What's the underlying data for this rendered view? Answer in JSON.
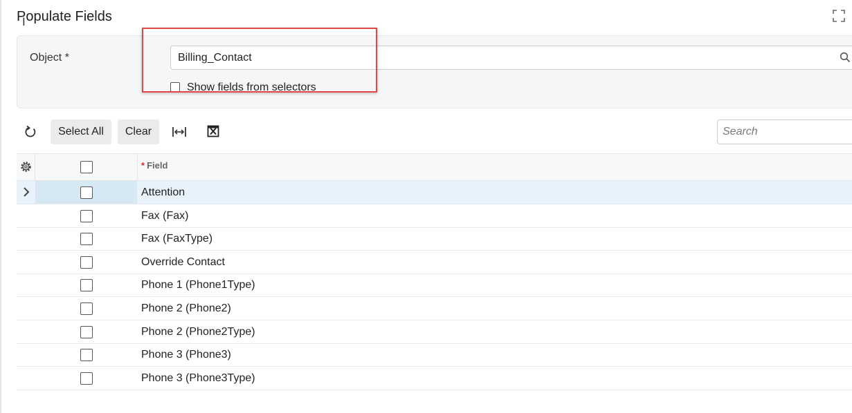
{
  "dialog": {
    "title": "Populate Fields",
    "maximize_icon": "expand-icon"
  },
  "form": {
    "object_label": "Object *",
    "object_value": "Billing_Contact",
    "object_lookup_icon": "search-icon",
    "show_selectors_label": "Show fields from selectors",
    "show_selectors_checked": false,
    "highlight_color": "#e04848"
  },
  "toolbar": {
    "refresh_icon": "refresh-icon",
    "select_all_label": "Select All",
    "clear_label": "Clear",
    "fit_columns_icon": "fit-columns-icon",
    "export_excel_icon": "excel-icon",
    "search_placeholder": "Search"
  },
  "grid": {
    "settings_icon": "gear-icon",
    "field_header_required": "*",
    "field_header": "Field",
    "rows": [
      {
        "field": "Attention",
        "selected": true,
        "checked": false
      },
      {
        "field": "Fax (Fax)",
        "selected": false,
        "checked": false
      },
      {
        "field": "Fax (FaxType)",
        "selected": false,
        "checked": false
      },
      {
        "field": "Override Contact",
        "selected": false,
        "checked": false
      },
      {
        "field": "Phone 1 (Phone1Type)",
        "selected": false,
        "checked": false
      },
      {
        "field": "Phone 2 (Phone2)",
        "selected": false,
        "checked": false
      },
      {
        "field": "Phone 2 (Phone2Type)",
        "selected": false,
        "checked": false
      },
      {
        "field": "Phone 3 (Phone3)",
        "selected": false,
        "checked": false
      },
      {
        "field": "Phone 3 (Phone3Type)",
        "selected": false,
        "checked": false
      }
    ]
  },
  "colors": {
    "selected_row": "#e8f2fa",
    "required_mark": "#d32f2f"
  }
}
